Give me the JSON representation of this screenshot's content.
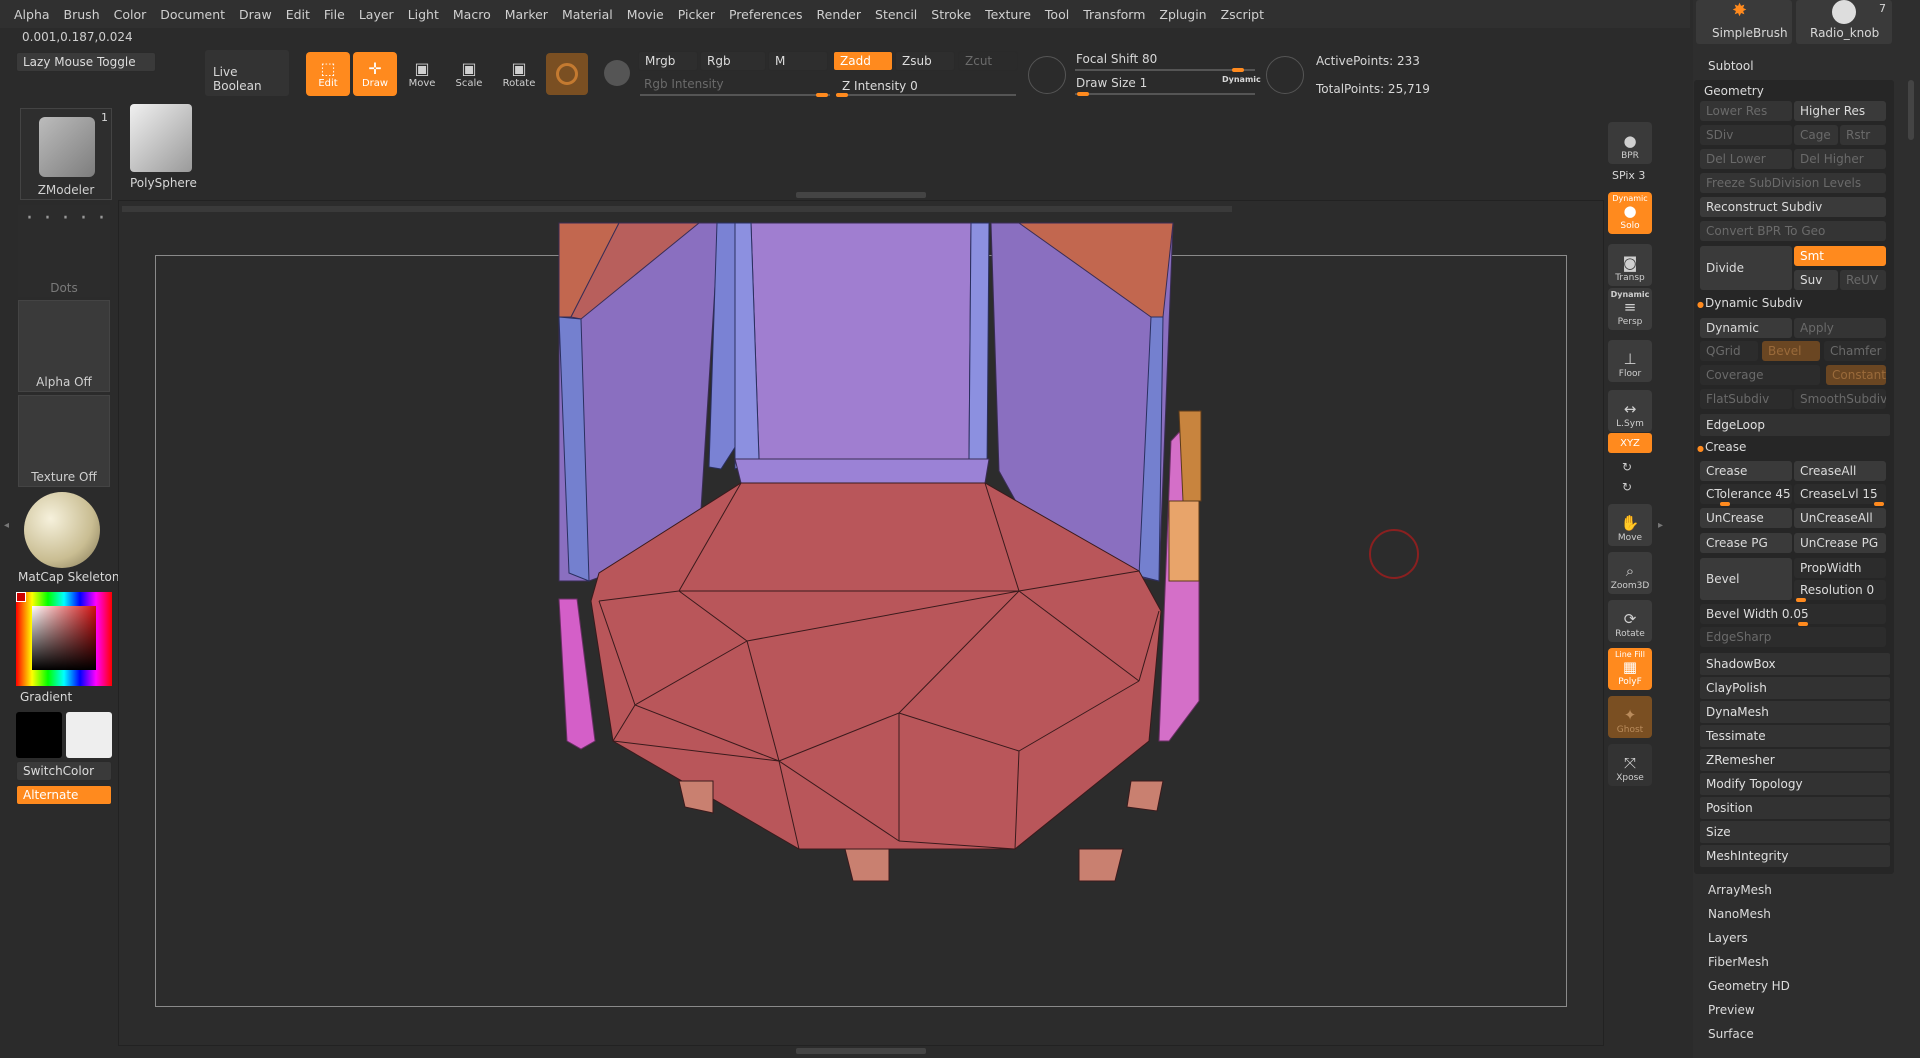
{
  "menu": [
    "Alpha",
    "Brush",
    "Color",
    "Document",
    "Draw",
    "Edit",
    "File",
    "Layer",
    "Light",
    "Macro",
    "Marker",
    "Material",
    "Movie",
    "Picker",
    "Preferences",
    "Render",
    "Stencil",
    "Stroke",
    "Texture",
    "Tool",
    "Transform",
    "Zplugin",
    "Zscript"
  ],
  "coords": "0.001,0.187,0.024",
  "lazy_mouse": "Lazy Mouse Toggle",
  "live_boolean": "Live Boolean",
  "tools": {
    "edit": "Edit",
    "draw": "Draw",
    "move": "Move",
    "scale": "Scale",
    "rotate": "Rotate"
  },
  "color_mode": {
    "mrgb": "Mrgb",
    "rgb": "Rgb",
    "m": "M",
    "rgb_intensity": "Rgb Intensity",
    "zadd": "Zadd",
    "zsub": "Zsub",
    "zcut": "Zcut",
    "z_intensity": "Z Intensity 0"
  },
  "focal_shift": "Focal Shift 80",
  "draw_size": "Draw Size 1",
  "dynamic": "Dynamic",
  "active_points": "ActivePoints: 233",
  "total_points": "TotalPoints: 25,719",
  "shelf": {
    "zmodeler": "ZModeler",
    "zmodeler_count": "1",
    "polysphere": "PolySphere",
    "dots": "Dots",
    "alpha": "Alpha Off",
    "texture": "Texture Off",
    "matcap": "MatCap Skeleton",
    "gradient": "Gradient",
    "switchcolor": "SwitchColor",
    "alternate": "Alternate"
  },
  "right_strip": {
    "bpr": "BPR",
    "spix": "SPix 3",
    "solo": "Solo",
    "dynamic": "Dynamic",
    "transp": "Transp",
    "persp": "Persp",
    "floor": "Floor",
    "lsym": "L.Sym",
    "xyz": "XYZ",
    "move": "Move",
    "zoom3d": "Zoom3D",
    "rotate": "Rotate",
    "polyf": "PolyF",
    "line_fill": "Line Fill",
    "ghost": "Ghost",
    "xpose": "Xpose"
  },
  "brushes": {
    "simple": "SimpleBrush",
    "radio": "Radio_knob",
    "radio_count": "7"
  },
  "panel": {
    "subtool": "Subtool",
    "geometry": "Geometry",
    "lower_res": "Lower Res",
    "higher_res": "Higher Res",
    "sdiv": "SDiv",
    "cage": "Cage",
    "rstr": "Rstr",
    "del_lower": "Del Lower",
    "del_higher": "Del Higher",
    "freeze": "Freeze SubDivision Levels",
    "reconstruct": "Reconstruct Subdiv",
    "convert_bpr": "Convert BPR To Geo",
    "divide": "Divide",
    "smt": "Smt",
    "suv": "Suv",
    "reuv": "ReUV",
    "dynamic_subdiv": "Dynamic Subdiv",
    "dynamic": "Dynamic",
    "apply": "Apply",
    "qgrid": "QGrid",
    "bevel_d": "Bevel",
    "chamfer": "Chamfer",
    "coverage": "Coverage",
    "constant": "Constant",
    "flatsubdiv": "FlatSubdiv",
    "smoothsubdiv": "SmoothSubdiv",
    "edgeloop": "EdgeLoop",
    "crease_sec": "Crease",
    "crease": "Crease",
    "creaseall": "CreaseAll",
    "ctolerance": "CTolerance 45",
    "creaselvl": "CreaseLvl 15",
    "uncrease": "UnCrease",
    "uncreaseall": "UnCreaseAll",
    "crease_pg": "Crease PG",
    "uncrease_pg": "UnCrease PG",
    "bevel": "Bevel",
    "propwidth": "PropWidth",
    "resolution": "Resolution 0",
    "bevel_width": "Bevel Width 0.05",
    "edgesharp": "EdgeSharp",
    "shadowbox": "ShadowBox",
    "claypolish": "ClayPolish",
    "dynamesh": "DynaMesh",
    "tessimate": "Tessimate",
    "zremesher": "ZRemesher",
    "modify_topology": "Modify Topology",
    "position": "Position",
    "size": "Size",
    "meshintegrity": "MeshIntegrity",
    "arraymesh": "ArrayMesh",
    "nanomesh": "NanoMesh",
    "layers": "Layers",
    "fibermesh": "FiberMesh",
    "geometry_hd": "Geometry HD",
    "preview": "Preview",
    "surface": "Surface"
  },
  "colors": {
    "accent": "#ff8a1e",
    "mesh_red": "#b9565a",
    "mesh_purple": "#9a78c8",
    "mesh_blue": "#7e86d6",
    "mesh_pink": "#d45fc8"
  }
}
